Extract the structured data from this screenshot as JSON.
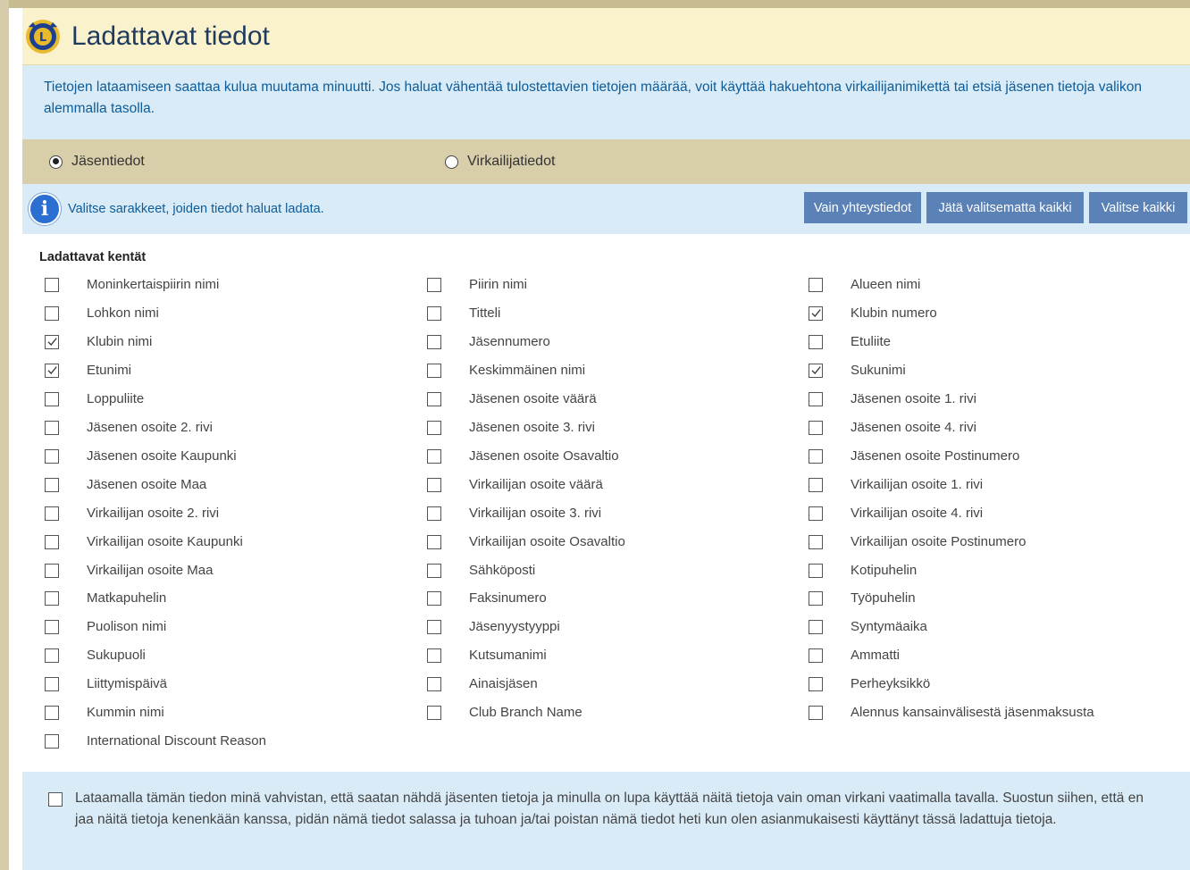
{
  "header": {
    "title": "Ladattavat tiedot",
    "logo_icon": "lions-logo-icon"
  },
  "notice": "Tietojen lataamiseen saattaa kulua muutama minuutti. Jos haluat vähentää tulostettavien tietojen määrää, voit käyttää hakuehtona virkailijanimikettä tai etsiä jäsenen tietoja valikon alemmalla tasolla.",
  "radios": [
    {
      "label": "Jäsentiedot",
      "checked": true
    },
    {
      "label": "Virkailijatiedot",
      "checked": false
    }
  ],
  "info": {
    "icon": "info-icon",
    "text": "Valitse sarakkeet, joiden tiedot haluat ladata.",
    "buttons": [
      "Vain yhteystiedot",
      "Jätä valitsematta kaikki",
      "Valitse kaikki"
    ]
  },
  "fields_title": "Ladattavat kentät",
  "fields": [
    {
      "label": "Moninkertaispiirin nimi",
      "checked": false
    },
    {
      "label": "Piirin nimi",
      "checked": false
    },
    {
      "label": "Alueen nimi",
      "checked": false
    },
    {
      "label": "Lohkon nimi",
      "checked": false
    },
    {
      "label": "Titteli",
      "checked": false
    },
    {
      "label": "Klubin numero",
      "checked": true
    },
    {
      "label": "Klubin nimi",
      "checked": true
    },
    {
      "label": "Jäsennumero",
      "checked": false
    },
    {
      "label": "Etuliite",
      "checked": false
    },
    {
      "label": "Etunimi",
      "checked": true
    },
    {
      "label": "Keskimmäinen nimi",
      "checked": false
    },
    {
      "label": "Sukunimi",
      "checked": true
    },
    {
      "label": "Loppuliite",
      "checked": false
    },
    {
      "label": "Jäsenen osoite väärä",
      "checked": false
    },
    {
      "label": "Jäsenen osoite 1. rivi",
      "checked": false
    },
    {
      "label": "Jäsenen osoite 2. rivi",
      "checked": false
    },
    {
      "label": "Jäsenen osoite 3. rivi",
      "checked": false
    },
    {
      "label": "Jäsenen osoite 4. rivi",
      "checked": false
    },
    {
      "label": "Jäsenen osoite Kaupunki",
      "checked": false
    },
    {
      "label": "Jäsenen osoite Osavaltio",
      "checked": false
    },
    {
      "label": "Jäsenen osoite Postinumero",
      "checked": false
    },
    {
      "label": "Jäsenen osoite Maa",
      "checked": false
    },
    {
      "label": "Virkailijan osoite väärä",
      "checked": false
    },
    {
      "label": "Virkailijan osoite 1. rivi",
      "checked": false
    },
    {
      "label": "Virkailijan osoite 2. rivi",
      "checked": false
    },
    {
      "label": "Virkailijan osoite 3. rivi",
      "checked": false
    },
    {
      "label": "Virkailijan osoite 4. rivi",
      "checked": false
    },
    {
      "label": "Virkailijan osoite Kaupunki",
      "checked": false
    },
    {
      "label": "Virkailijan osoite Osavaltio",
      "checked": false
    },
    {
      "label": "Virkailijan osoite Postinumero",
      "checked": false
    },
    {
      "label": "Virkailijan osoite Maa",
      "checked": false
    },
    {
      "label": "Sähköposti",
      "checked": false
    },
    {
      "label": "Kotipuhelin",
      "checked": false
    },
    {
      "label": "Matkapuhelin",
      "checked": false
    },
    {
      "label": "Faksinumero",
      "checked": false
    },
    {
      "label": "Työpuhelin",
      "checked": false
    },
    {
      "label": "Puolison nimi",
      "checked": false
    },
    {
      "label": "Jäsenyystyyppi",
      "checked": false
    },
    {
      "label": "Syntymäaika",
      "checked": false
    },
    {
      "label": "Sukupuoli",
      "checked": false
    },
    {
      "label": "Kutsumanimi",
      "checked": false
    },
    {
      "label": "Ammatti",
      "checked": false
    },
    {
      "label": "Liittymispäivä",
      "checked": false
    },
    {
      "label": "Ainaisjäsen",
      "checked": false
    },
    {
      "label": "Perheyksikkö",
      "checked": false
    },
    {
      "label": "Kummin nimi",
      "checked": false
    },
    {
      "label": "Club Branch Name",
      "checked": false
    },
    {
      "label": "Alennus kansainvälisestä jäsenmaksusta",
      "checked": false
    },
    {
      "label": "International Discount Reason",
      "checked": false
    }
  ],
  "consent": {
    "checked": false,
    "text": "Lataamalla tämän tiedon minä vahvistan, että saatan nähdä jäsenten tietoja ja minulla on lupa käyttää näitä tietoja vain oman virkani vaatimalla tavalla. Suostun siihen, että en jaa näitä tietoja kenenkään kanssa, pidän nämä tiedot salassa ja tuhoan ja/tai poistan nämä tiedot heti kun olen asianmukaisesti käyttänyt tässä ladattuja tietoja."
  },
  "colors": {
    "accent": "#5b82b7",
    "notice_text": "#0e5c99",
    "header_bg": "#faf2cc",
    "bar_bg": "#d8ceaa",
    "info_bg": "#d9ebf7"
  }
}
